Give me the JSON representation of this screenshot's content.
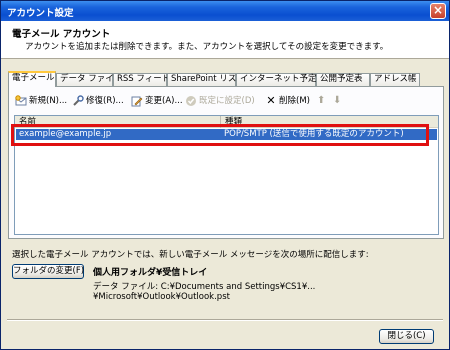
{
  "window": {
    "title": "アカウント設定"
  },
  "header": {
    "title": "電子メール アカウント",
    "subtitle": "アカウントを追加または削除できます。また、アカウントを選択してその設定を変更できます。"
  },
  "tabs": [
    {
      "label": "電子メール"
    },
    {
      "label": "データ ファイル"
    },
    {
      "label": "RSS フィード"
    },
    {
      "label": "SharePoint リスト"
    },
    {
      "label": "インターネット予定表"
    },
    {
      "label": "公開予定表"
    },
    {
      "label": "アドレス帳"
    }
  ],
  "toolbar": {
    "new_label": "新規(N)...",
    "repair_label": "修復(R)...",
    "change_label": "変更(A)...",
    "set_default_label": "既定に設定(D)",
    "delete_label": "削除(M)"
  },
  "list": {
    "columns": [
      "名前",
      "種類"
    ],
    "rows": [
      {
        "name": "example@example.jp",
        "type": "POP/SMTP (送信で使用する既定のアカウント)"
      }
    ]
  },
  "delivery": {
    "description": "選択した電子メール アカウントでは、新しい電子メール メッセージを次の場所に配信します:",
    "change_folder_label": "フォルダの変更(F)",
    "folder": "個人用フォルダ¥受信トレイ",
    "data_file": "データ ファイル: C:¥Documents and Settings¥CS1¥...¥Microsoft¥Outlook¥Outlook.pst"
  },
  "close_label": "閉じる(C)"
}
